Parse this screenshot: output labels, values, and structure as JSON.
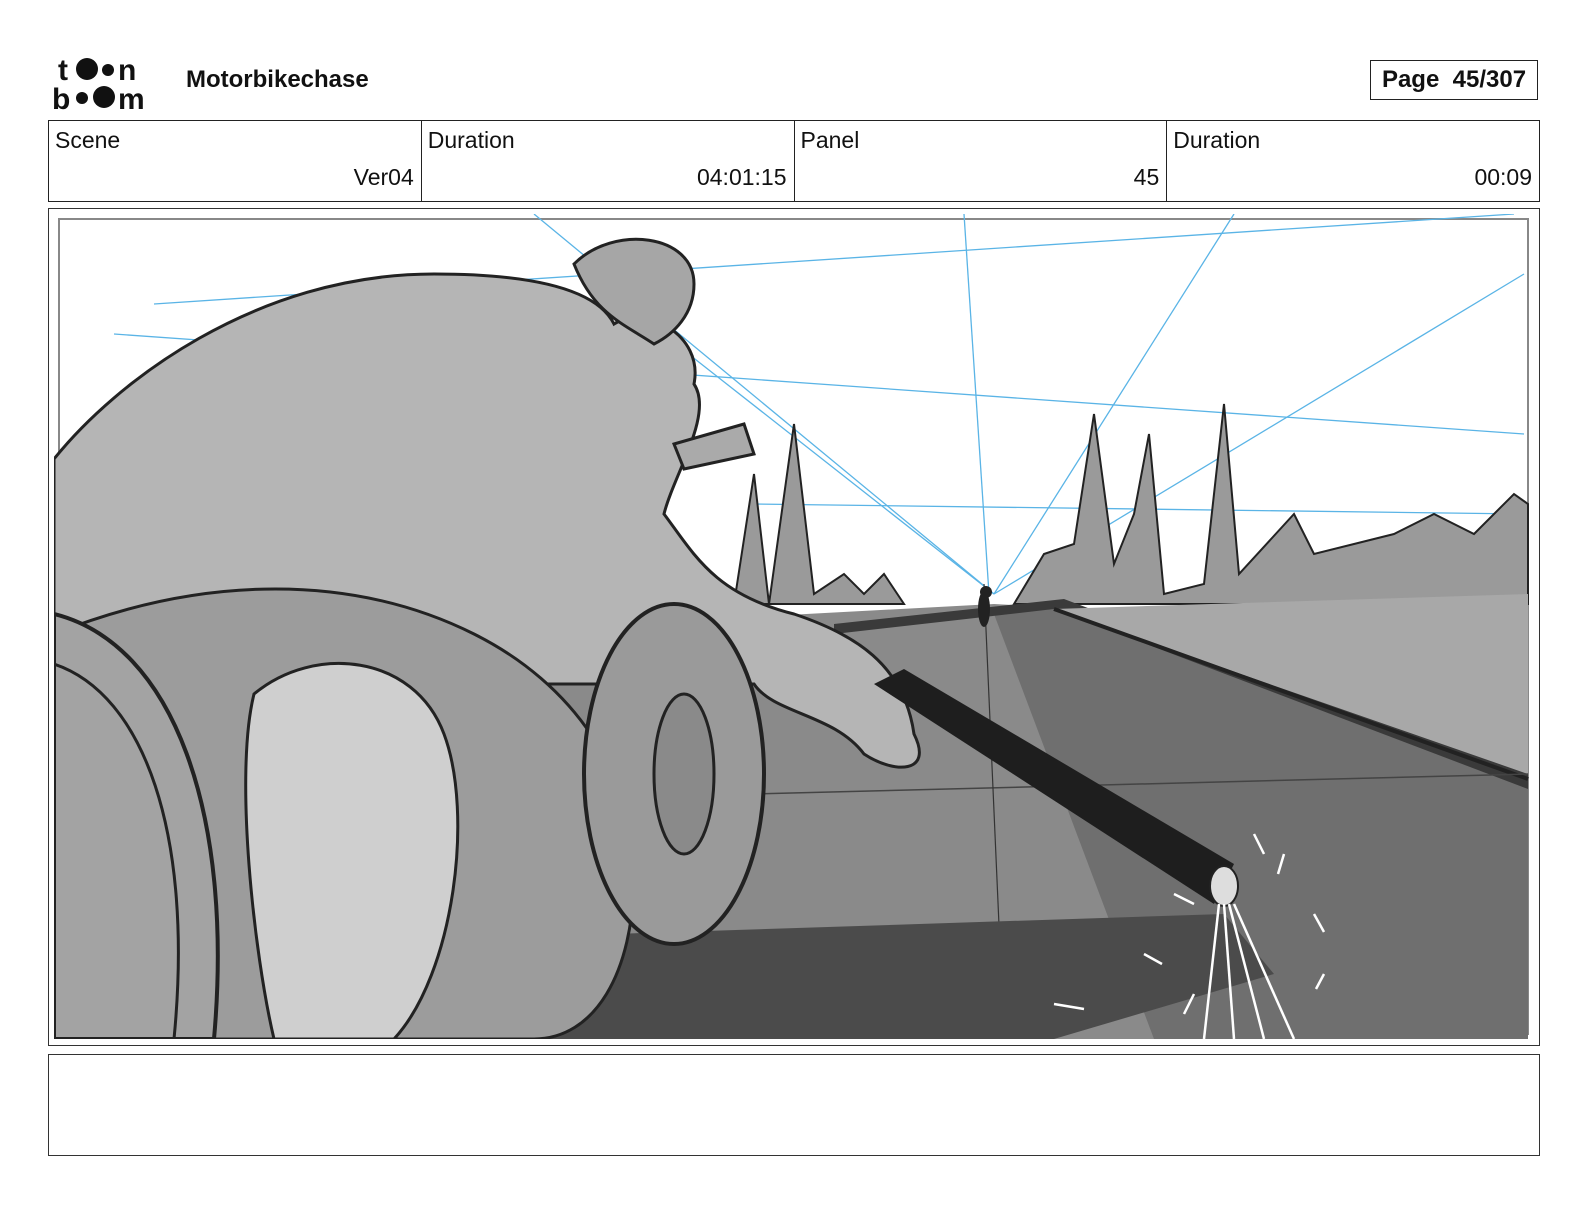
{
  "header": {
    "logo": {
      "line1": "toon",
      "line2": "boom"
    },
    "project_title": "Motorbikechase",
    "page_label": "Page",
    "page_value": "45/307"
  },
  "info": {
    "scene_label": "Scene",
    "scene_value": "Ver04",
    "scene_duration_label": "Duration",
    "scene_duration_value": "04:01:15",
    "panel_label": "Panel",
    "panel_value": "45",
    "panel_duration_label": "Duration",
    "panel_duration_value": "00:09"
  },
  "panel_image": {
    "icon": "storyboard-sketch",
    "subject": "motorbike rider dragging pole with sparks on road"
  },
  "notes": {
    "text": ""
  },
  "colors": {
    "border": "#222222",
    "construction_lines": "#5ab4e6",
    "sky": "#ffffff",
    "road": "#8a8a8a"
  }
}
